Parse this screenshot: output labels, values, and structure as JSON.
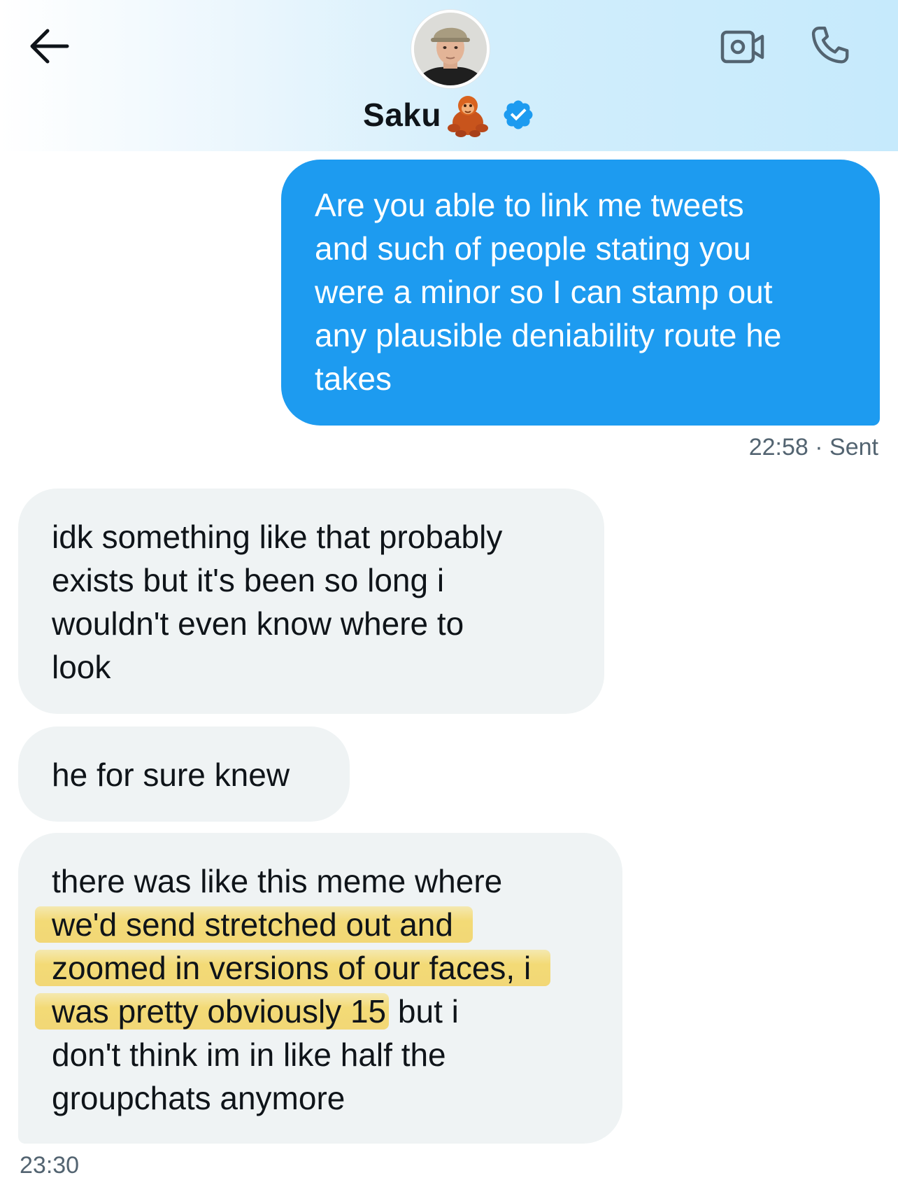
{
  "header": {
    "contact_name": "Saku",
    "verified": true,
    "back_icon": "arrow-left-icon",
    "video_icon": "video-camera-icon",
    "call_icon": "phone-icon",
    "accent_color": "#1d9bf0"
  },
  "messages": [
    {
      "direction": "sent",
      "lines": [
        "Are you able to link me tweets",
        "and such of people stating you",
        "were a minor so I can stamp out",
        "any plausible deniability route he",
        "takes"
      ],
      "time": "22:58",
      "status": "Sent"
    },
    {
      "direction": "received",
      "lines": [
        "idk something like that probably",
        "exists but it's been so long i",
        "wouldn't even know where to",
        "look"
      ]
    },
    {
      "direction": "received",
      "lines": [
        "he for sure knew"
      ]
    },
    {
      "direction": "received",
      "lines": [
        "there was like this meme where",
        "we'd send stretched out and",
        "zoomed in versions of our faces, i",
        "was pretty obviously 15",
        "but i",
        "don't think im in like half the",
        "groupchats anymore"
      ],
      "time": "23:30"
    }
  ],
  "highlight_color": "#f2d056",
  "sent_bubble_color": "#1d9bf0",
  "received_bubble_color": "#eff3f4"
}
